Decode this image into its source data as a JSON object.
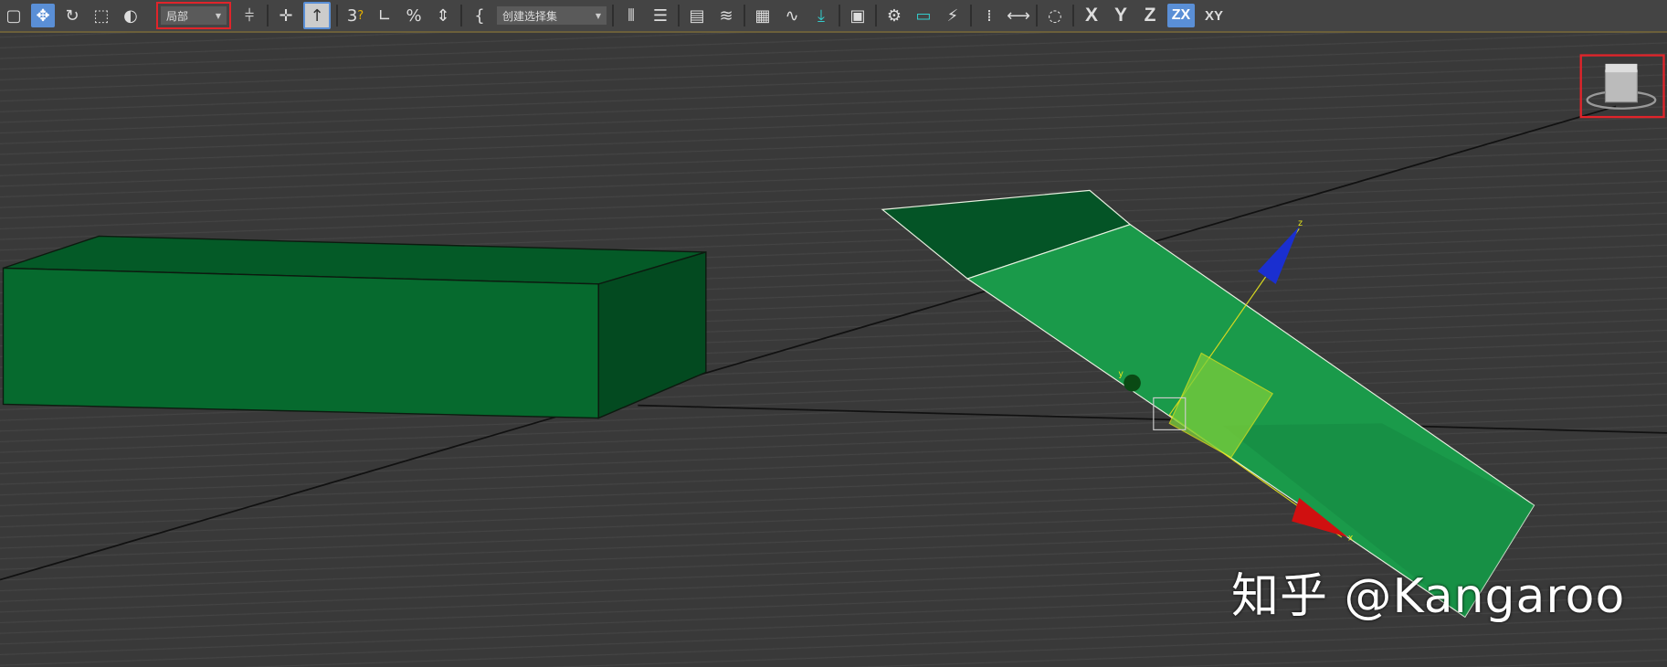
{
  "toolbar": {
    "coordinate_system": "局部",
    "named_selection_set": "创建选择集",
    "axis_x": "X",
    "axis_y": "Y",
    "axis_z": "Z",
    "axis_zx": "ZX",
    "axis_xy": "XY",
    "snap_3": "3",
    "percent": "%"
  },
  "viewport": {
    "gizmo_labels": {
      "x": "x",
      "y": "y",
      "z": "z"
    },
    "object_color": "#055f2a",
    "plane_color": "#1a9a4a"
  },
  "watermark": "知乎 @Kangaroo"
}
